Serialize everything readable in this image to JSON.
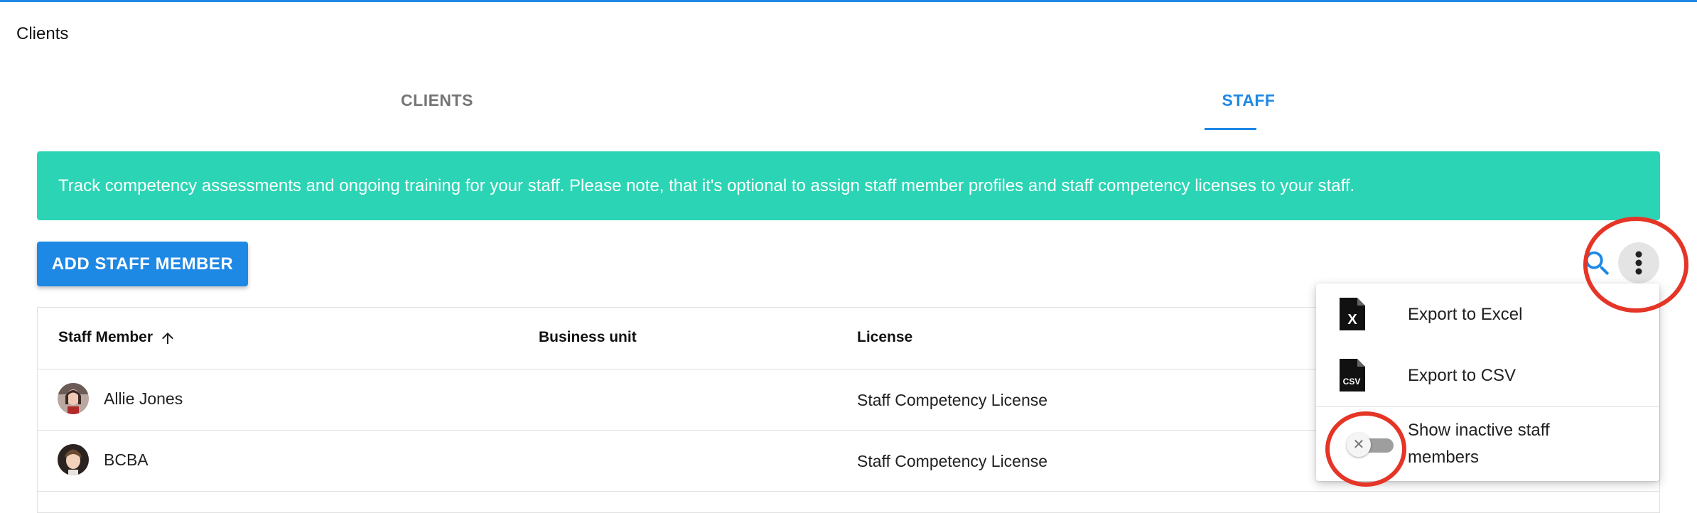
{
  "page": {
    "title": "Clients"
  },
  "tabs": [
    {
      "label": "CLIENTS",
      "active": false
    },
    {
      "label": "STAFF",
      "active": true
    }
  ],
  "banner": {
    "text": "Track competency assessments and ongoing training for your staff. Please note, that it's optional to assign staff member profiles and staff competency licenses to your staff."
  },
  "toolbar": {
    "add_label": "ADD STAFF MEMBER",
    "search_icon": "search-icon",
    "more_icon": "more-vert-icon"
  },
  "table": {
    "columns": [
      "Staff Member",
      "Business unit",
      "License"
    ],
    "sort": {
      "column": "Staff Member",
      "direction": "ascending"
    },
    "rows": [
      {
        "name": "Allie Jones",
        "business_unit": "",
        "license": "Staff Competency License"
      },
      {
        "name": "BCBA",
        "business_unit": "",
        "license": "Staff Competency License"
      }
    ]
  },
  "menu": {
    "items": [
      {
        "label": "Export to Excel",
        "icon": "excel-file-icon"
      },
      {
        "label": "Export to CSV",
        "icon": "csv-file-icon"
      }
    ],
    "toggle": {
      "label": "Show inactive staff members",
      "checked": false
    }
  },
  "colors": {
    "primary": "#1e88e5",
    "banner": "#2bd4b4",
    "highlight": "#e53527"
  }
}
